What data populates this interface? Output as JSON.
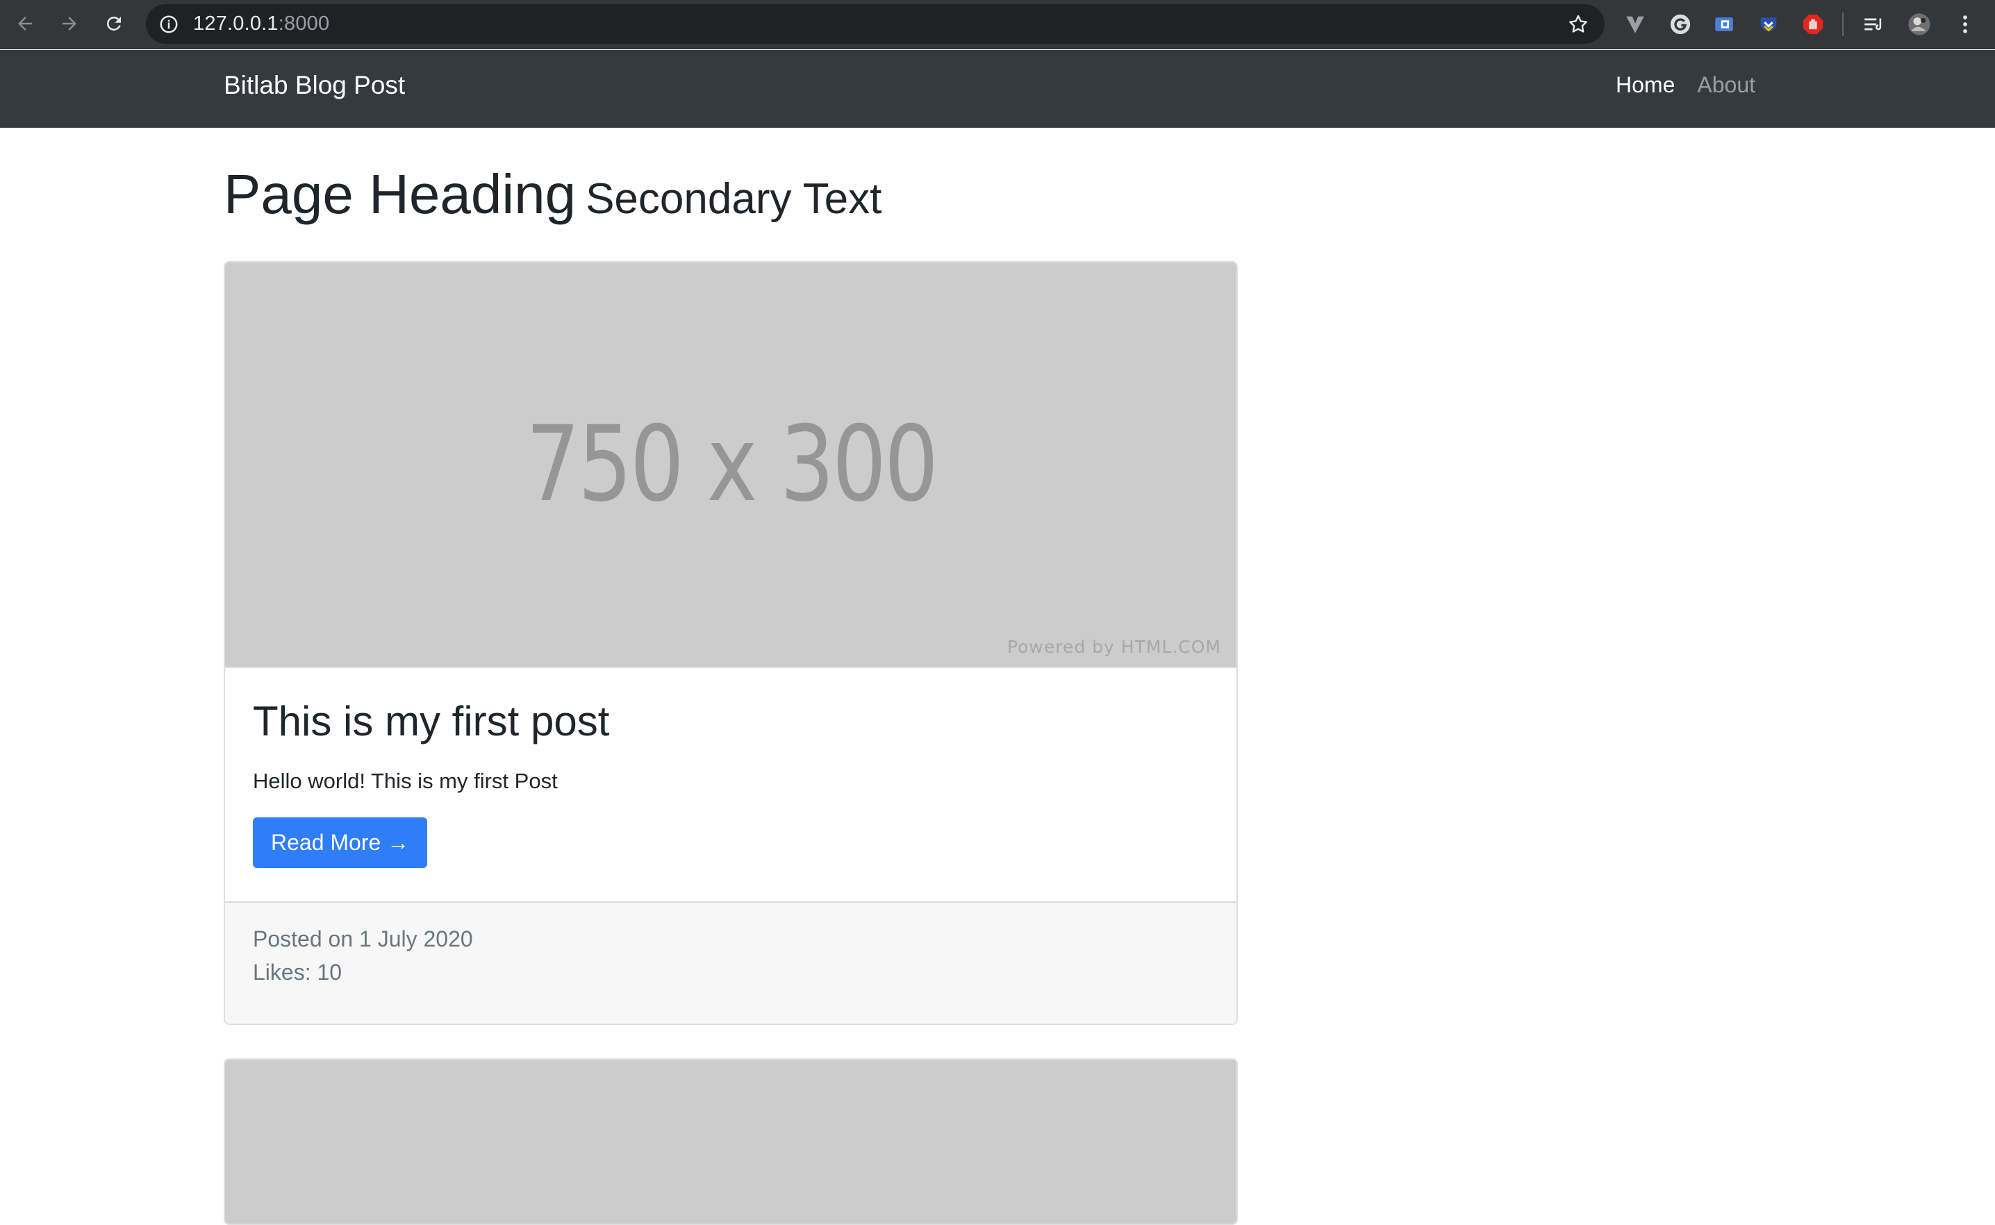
{
  "browser": {
    "url_host": "127.0.0.1",
    "url_port": ":8000",
    "icons": [
      "back-arrow-icon",
      "forward-arrow-icon",
      "reload-icon",
      "site-info-icon",
      "bookmark-star-icon",
      "vivaldi-extension-icon",
      "grammarly-extension-icon",
      "translate-extension-icon",
      "pocket-extension-icon",
      "adblock-extension-icon",
      "media-queue-icon",
      "profile-avatar-icon",
      "kebab-menu-icon"
    ]
  },
  "navbar": {
    "brand": "Bitlab Blog Post",
    "links": [
      {
        "label": "Home",
        "active": true
      },
      {
        "label": "About",
        "active": false
      }
    ]
  },
  "page": {
    "heading": "Page Heading",
    "subheading": "Secondary Text"
  },
  "posts": [
    {
      "image_text": "750 x 300",
      "image_credit": "Powered by HTML.COM",
      "title": "This is my first post",
      "body": "Hello world! This is my first Post",
      "button_label": "Read More →",
      "posted": "Posted on 1 July 2020",
      "likes": "Likes: 10"
    }
  ],
  "colors": {
    "chrome_bg": "#35363a",
    "omnibox_bg": "#202124",
    "navbar_bg": "#343a40",
    "primary": "#2f7df7",
    "placeholder_bg": "#cccccc"
  }
}
